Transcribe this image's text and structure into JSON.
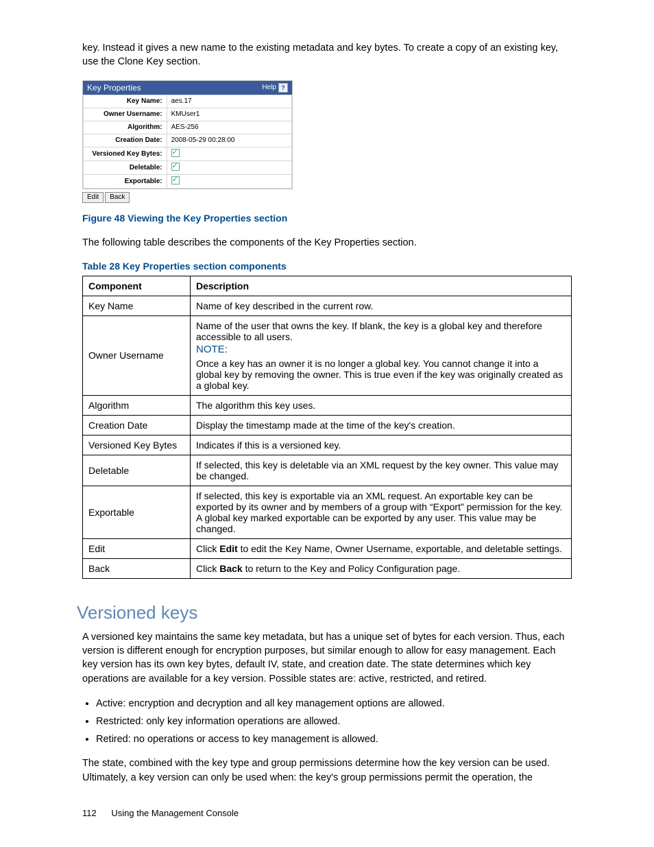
{
  "intro_paragraph": "key. Instead it gives a new name to the existing metadata and key bytes. To create a copy of an existing key, use the Clone Key section.",
  "kp_panel": {
    "title": "Key Properties",
    "help_label": "Help",
    "rows": [
      {
        "label": "Key Name:",
        "value": "aes.17"
      },
      {
        "label": "Owner Username:",
        "value": "KMUser1"
      },
      {
        "label": "Algorithm:",
        "value": "AES-256"
      },
      {
        "label": "Creation Date:",
        "value": "2008-05-29 00:28:00"
      },
      {
        "label": "Versioned Key Bytes:",
        "value": "check"
      },
      {
        "label": "Deletable:",
        "value": "check"
      },
      {
        "label": "Exportable:",
        "value": "check"
      }
    ],
    "buttons": {
      "edit": "Edit",
      "back": "Back"
    }
  },
  "figure_caption": "Figure 48 Viewing the Key Properties section",
  "lead_sentence": "The following table describes the components of the Key Properties section.",
  "table_caption": "Table 28 Key Properties section components",
  "table_headers": {
    "c1": "Component",
    "c2": "Description"
  },
  "rows": {
    "key_name": {
      "c": "Key Name",
      "d": "Name of key described in the current row."
    },
    "owner": {
      "c": "Owner Username",
      "d1": "Name of the user that owns the key. If blank, the key is a global key and therefore accessible to all users.",
      "note": "NOTE:",
      "d2": "Once a key has an owner it is no longer a global key. You cannot change it into a global key by removing the owner. This is true even if the key was originally created as a global key."
    },
    "algorithm": {
      "c": "Algorithm",
      "d": "The algorithm this key uses."
    },
    "created": {
      "c": "Creation Date",
      "d": "Display the timestamp made at the time of the key's creation."
    },
    "versioned": {
      "c": "Versioned Key Bytes",
      "d": "Indicates if this is a versioned key."
    },
    "deletable": {
      "c": "Deletable",
      "d": "If selected, this key is deletable via an XML request by the key owner. This value may be changed."
    },
    "exportable": {
      "c": "Exportable",
      "d": "If selected, this key is exportable via an XML request. An exportable key can be exported by its owner and by members of a group with “Export” permission for the key. A global key marked exportable can be exported by any user. This value may be changed."
    },
    "edit": {
      "c": "Edit",
      "d_pre": "Click ",
      "d_bold": "Edit",
      "d_post": " to edit the Key Name, Owner Username, exportable, and deletable settings."
    },
    "back": {
      "c": "Back",
      "d_pre": "Click ",
      "d_bold": "Back",
      "d_post": " to return to the Key and Policy Configuration page."
    }
  },
  "section_heading": "Versioned keys",
  "section_para1": "A versioned key maintains the same key metadata, but has a unique set of bytes for each version. Thus, each version is different enough for encryption purposes, but similar enough to allow for easy management. Each key version has its own key bytes, default IV, state, and creation date. The state determines which key operations are available for a key version. Possible states are: active, restricted, and retired.",
  "states": {
    "active": "Active: encryption and decryption and all key management options are allowed.",
    "restricted": "Restricted: only key information operations are allowed.",
    "retired": "Retired: no operations or access to key management is allowed."
  },
  "section_para2": "The state, combined with the key type and group permissions determine how the key version can be used. Ultimately, a key version can only be used when: the key's group permissions permit the operation, the",
  "footer": {
    "page_number": "112",
    "section_title": "Using the Management Console"
  }
}
